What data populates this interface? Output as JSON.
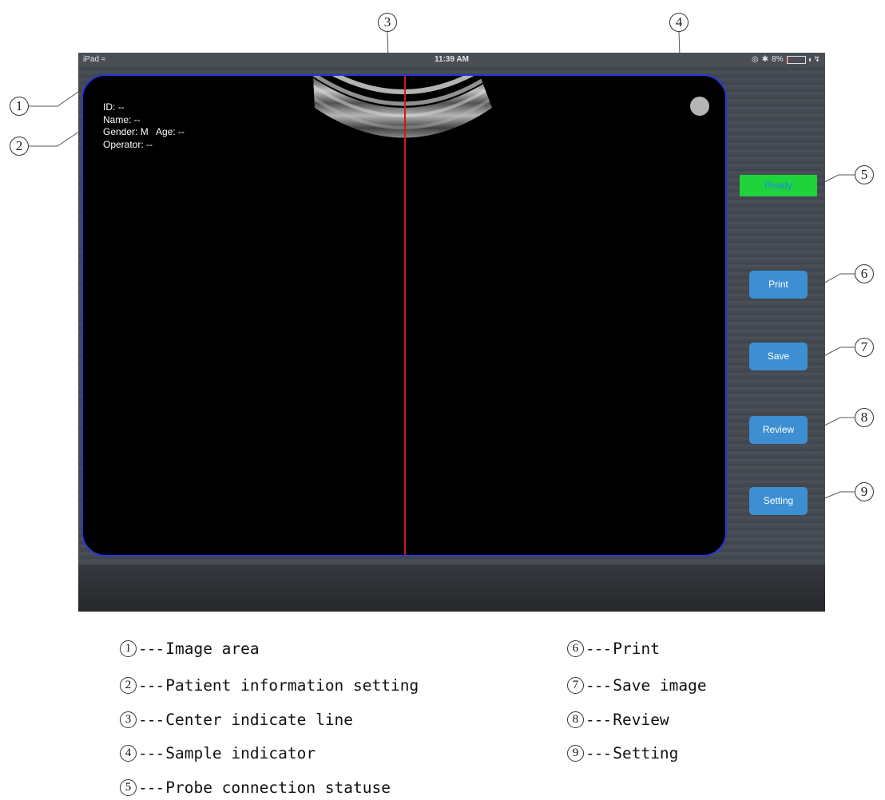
{
  "statusbar": {
    "device": "iPad",
    "time": "11:39 AM",
    "battery": "8%",
    "battery_level": 0.08
  },
  "patient": {
    "id": "ID: --",
    "name": "Name: --",
    "gender_age": "Gender: M   Age: --",
    "operator": "Operator: --"
  },
  "probe_status": {
    "label": "Ready",
    "color": "#1fd33a"
  },
  "buttons": {
    "print": "Print",
    "save": "Save",
    "review": "Review",
    "setting": "Setting"
  },
  "callouts": [
    "1",
    "2",
    "3",
    "4",
    "5",
    "6",
    "7",
    "8",
    "9"
  ],
  "legend": [
    {
      "num": "1",
      "text": "Image area"
    },
    {
      "num": "2",
      "text": "Patient information setting"
    },
    {
      "num": "3",
      "text": "Center indicate line"
    },
    {
      "num": "4",
      "text": "Sample indicator"
    },
    {
      "num": "5",
      "text": "Probe connection statuse"
    },
    {
      "num": "6",
      "text": "Print"
    },
    {
      "num": "7",
      "text": "Save image"
    },
    {
      "num": "8",
      "text": "Review"
    },
    {
      "num": "9",
      "text": "Setting"
    }
  ],
  "legend_separator": "---",
  "colors": {
    "image_border": "#2a36d6",
    "center_line": "#d01818",
    "button": "#3d8fd2",
    "ready_text": "#1d8af0"
  }
}
